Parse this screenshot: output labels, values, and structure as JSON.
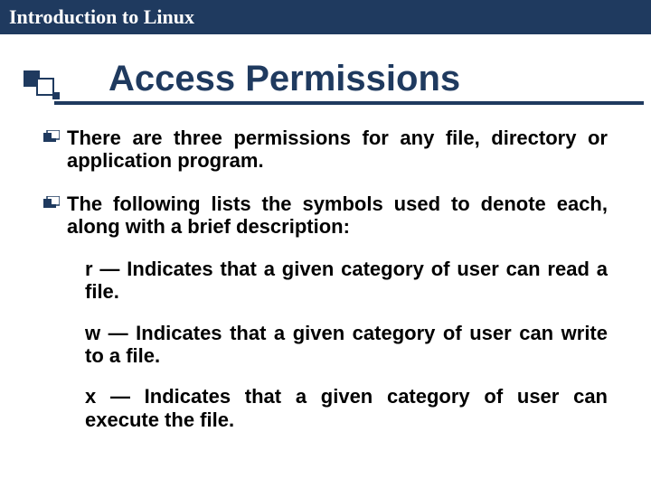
{
  "header": {
    "title": "Introduction to Linux"
  },
  "slide": {
    "title": "Access Permissions",
    "bullets": [
      {
        "text": "There are three permissions for any file, directory or application program."
      },
      {
        "text": "The following lists the symbols used to denote each, along with a brief description:"
      }
    ],
    "subitems": [
      {
        "text": " r — Indicates that a given category of  user can read a file."
      },
      {
        "text": " w — Indicates that a given category of user can write to a file."
      },
      {
        "text": " x — Indicates that a given category of user can execute the file."
      }
    ]
  }
}
